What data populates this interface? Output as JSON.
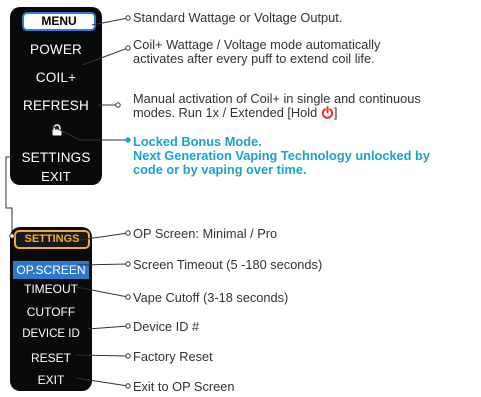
{
  "menu": {
    "header": "MENU",
    "items": [
      {
        "label": "POWER"
      },
      {
        "label": "COIL+"
      },
      {
        "label": "REFRESH"
      },
      {
        "label": ""
      },
      {
        "label": "SETTINGS"
      },
      {
        "label": "EXIT"
      }
    ]
  },
  "settings_menu": {
    "header": "SETTINGS",
    "items": [
      {
        "label": "OP.SCREEN"
      },
      {
        "label": "TIMEOUT"
      },
      {
        "label": "CUTOFF"
      },
      {
        "label": "DEVICE ID"
      },
      {
        "label": "RESET"
      },
      {
        "label": "EXIT"
      }
    ]
  },
  "menu_annotations": {
    "menu": "Standard Wattage or Voltage Output.",
    "coil_line1": "Coil+ Wattage / Voltage mode automatically",
    "coil_line2": "activates after every puff to extend coil life.",
    "refresh_line1": "Manual activation of Coil+ in single and continuous",
    "refresh_line2": "modes. Run 1x / Extended [Hold",
    "refresh_line2_end": "]",
    "locked_line1": "Locked Bonus Mode.",
    "locked_line2": "Next Generation Vaping Technology unlocked by",
    "locked_line3": "code or by vaping over time."
  },
  "settings_annotations": {
    "op_screen": "OP Screen: Minimal / Pro",
    "timeout": "Screen Timeout (5 -180 seconds)",
    "cutoff": "Vape Cutoff (3-18 seconds)",
    "device_id": "Device ID #",
    "reset": "Factory Reset",
    "exit": "Exit to OP Screen"
  },
  "colors": {
    "accent_text": "#1aa3c9",
    "menu_header_border": "#2b7fd9",
    "settings_header_border": "#f2a93b",
    "selected_item": "#2d78c8",
    "power_icon": "#e8322c",
    "screen_bg": "#0a0a0a"
  },
  "icons": [
    "lock-icon",
    "power-icon"
  ]
}
